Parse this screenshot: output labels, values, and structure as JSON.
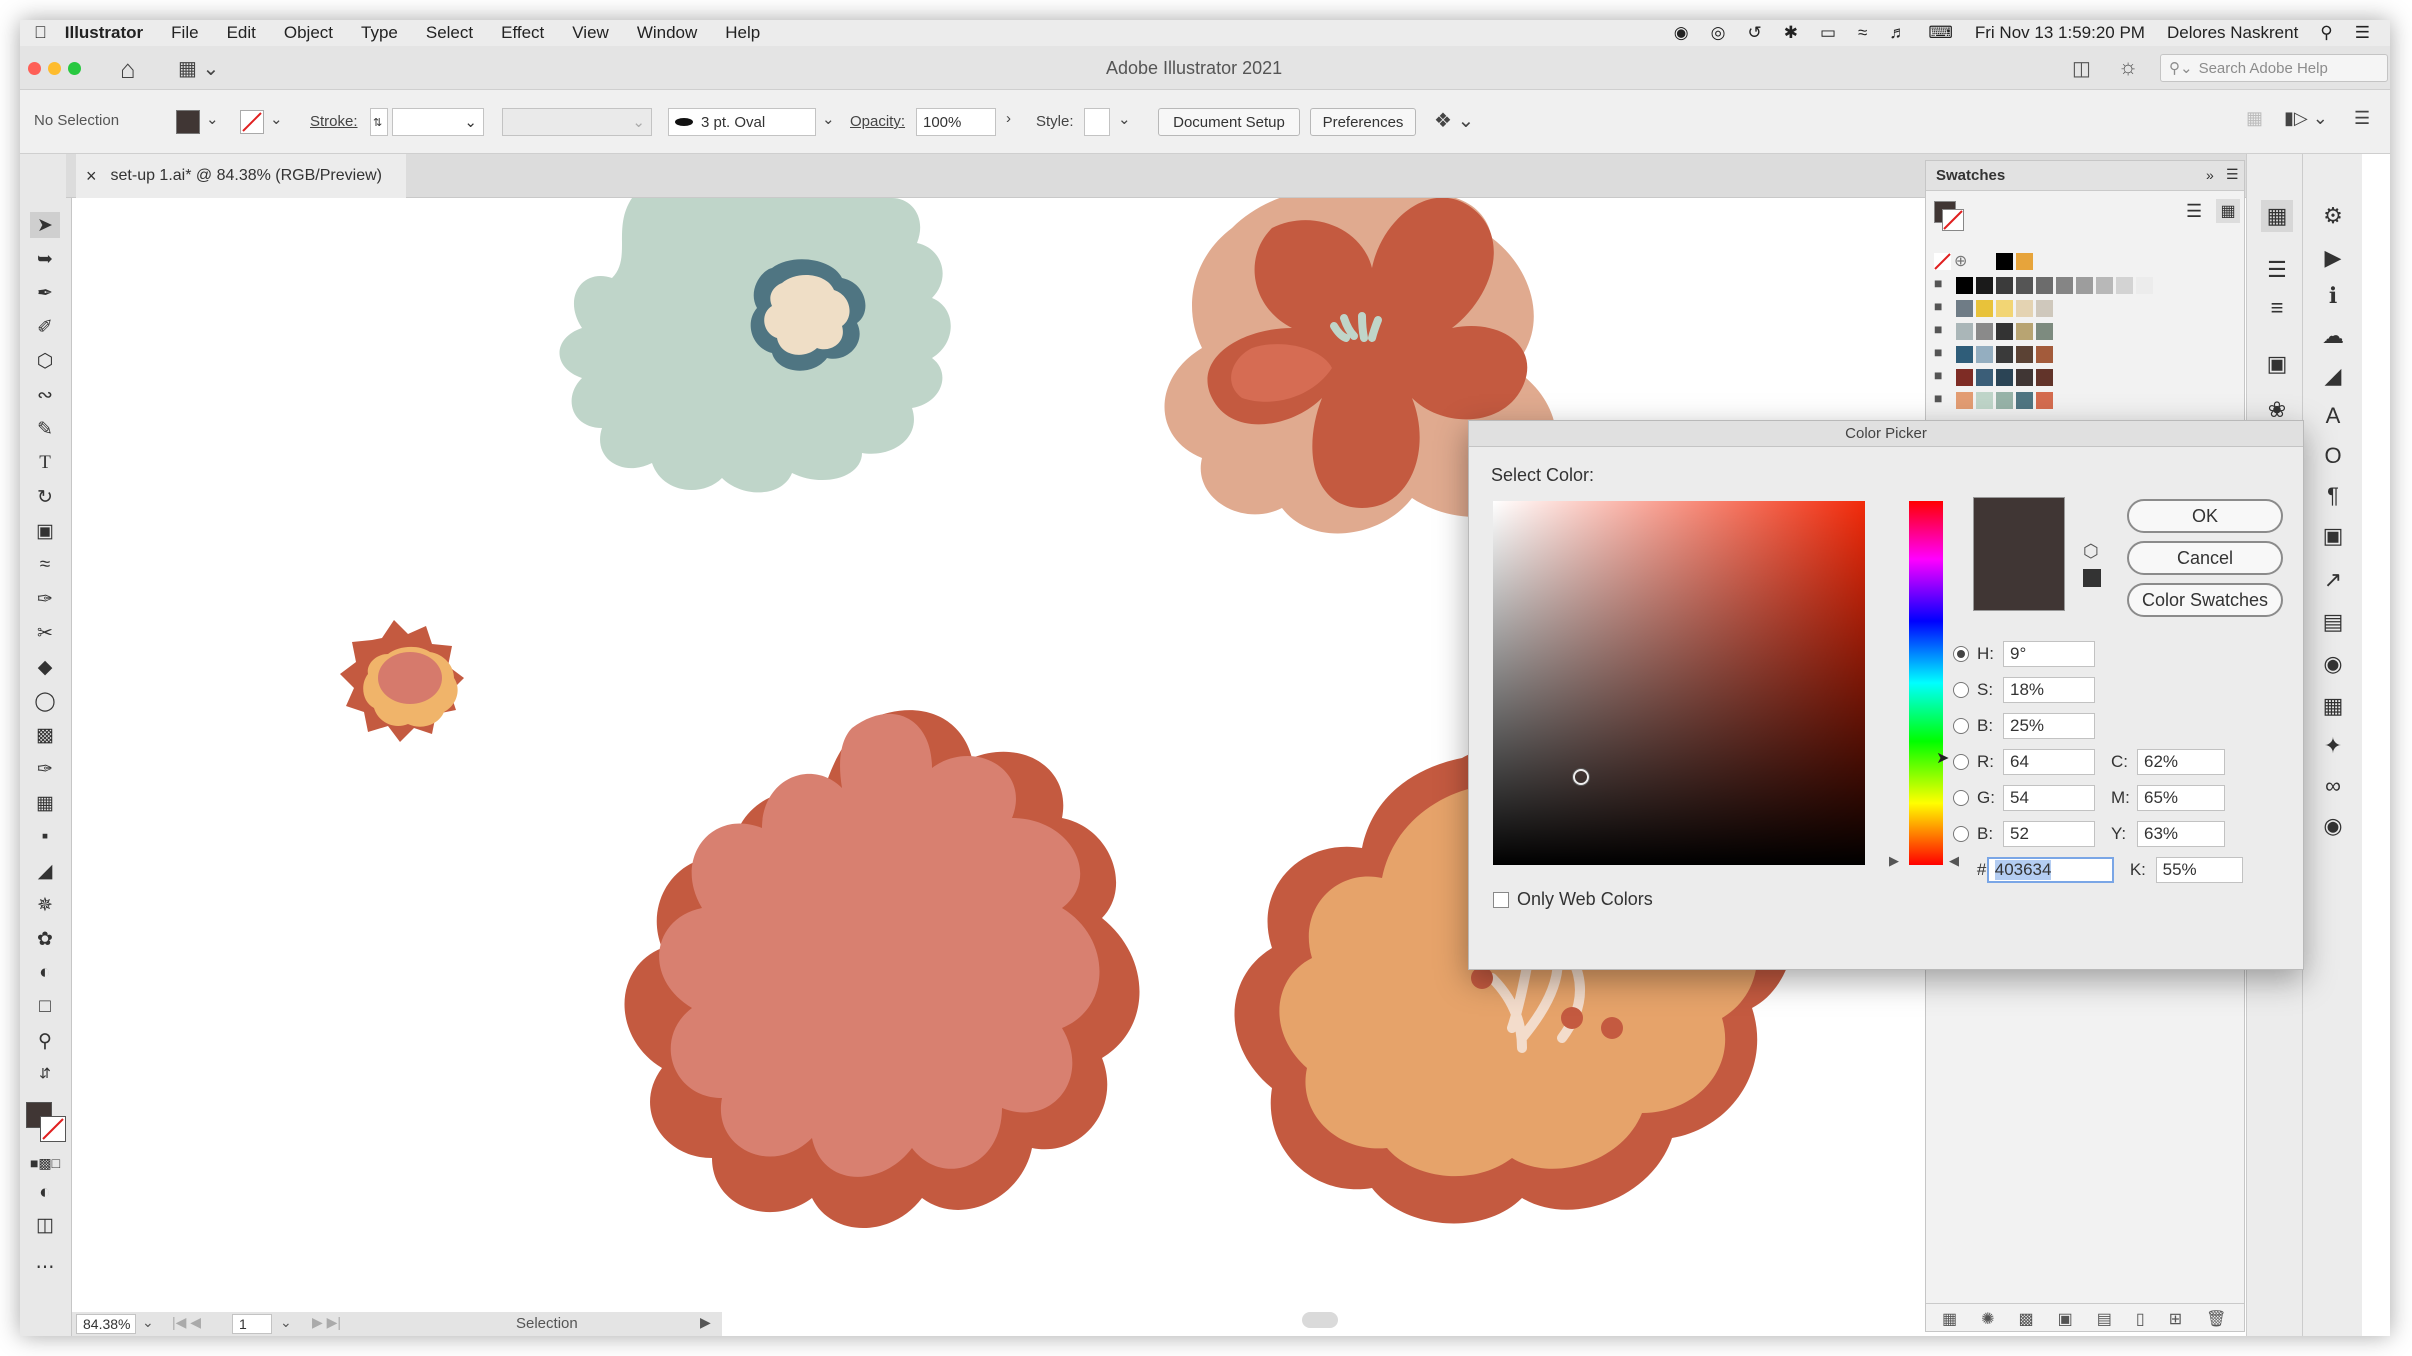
{
  "menubar": {
    "app_name": "Illustrator",
    "items": [
      "File",
      "Edit",
      "Object",
      "Type",
      "Select",
      "Effect",
      "View",
      "Window",
      "Help"
    ],
    "datetime": "Fri Nov 13  1:59:20 PM",
    "user": "Delores Naskrent"
  },
  "titlebar": {
    "title": "Adobe Illustrator 2021",
    "search_placeholder": "Search Adobe Help"
  },
  "control_bar": {
    "selection_status": "No Selection",
    "stroke_label": "Stroke:",
    "brush": "3 pt. Oval",
    "opacity_label": "Opacity:",
    "opacity_value": "100%",
    "style_label": "Style:",
    "document_setup": "Document Setup",
    "preferences": "Preferences",
    "fill_color": "#403634"
  },
  "document_tab": {
    "close": "×",
    "title": "set-up 1.ai* @ 84.38% (RGB/Preview)"
  },
  "statusbar": {
    "zoom": "84.38%",
    "artboard": "1",
    "tool": "Selection"
  },
  "swatches_panel": {
    "title": "Swatches",
    "colors": [
      [
        "#000000",
        "#1a1a1a",
        "#3b3b3b",
        "#555555",
        "#6c6c6c",
        "#858585",
        "#9d9d9d",
        "#b8b8b8",
        "#d3d3d3",
        "#ececec"
      ],
      [
        "#6f7c86",
        "#e8c23a",
        "#f2d574",
        "#e4d3b2",
        "#cfc8bc"
      ],
      [
        "#aab6b8",
        "#8a8a8a",
        "#333333",
        "#b8a472",
        "#7d8b7f"
      ],
      [
        "#2f5d79",
        "#94aec0",
        "#3a3a3a",
        "#5b4234",
        "#a35b3b"
      ],
      [
        "#7e2c25",
        "#3b5e78",
        "#2b4455",
        "#403634",
        "#62342a"
      ],
      [
        "#e39d73",
        "#bfd5c9",
        "#97b3a8",
        "#4f7582",
        "#d46c4f"
      ]
    ],
    "top_colors": [
      "#000000",
      "#e7a43b"
    ]
  },
  "color_picker": {
    "title": "Color Picker",
    "select_label": "Select Color:",
    "ok": "OK",
    "cancel": "Cancel",
    "color_swatches": "Color Swatches",
    "h_label": "H:",
    "h_value": "9°",
    "s_label": "S:",
    "s_value": "18%",
    "b_label": "B:",
    "b_value": "25%",
    "r_label": "R:",
    "r_value": "64",
    "g_label": "G:",
    "g_value": "54",
    "b2_label": "B:",
    "b2_value": "52",
    "hex_label": "#",
    "hex_value": "403634",
    "c_label": "C:",
    "c_value": "62%",
    "m_label": "M:",
    "m_value": "65%",
    "y_label": "Y:",
    "y_value": "63%",
    "k_label": "K:",
    "k_value": "55%",
    "web_colors": "Only Web Colors",
    "preview_color": "#403634"
  }
}
